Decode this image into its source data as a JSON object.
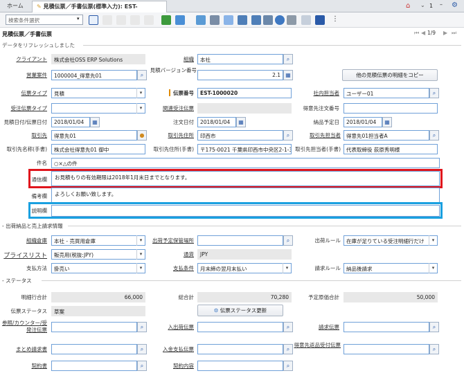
{
  "tabs": {
    "home": "ホーム",
    "active": "見積伝票／手書伝票(標準入力): EST-1000020"
  },
  "header": {
    "count": "1"
  },
  "search": {
    "placeholder": "検索条件選択"
  },
  "page": {
    "title": "見積伝票／手書伝票",
    "refresh_msg": "データをリフレッシュしました",
    "pager": "1/9"
  },
  "labels": {
    "client": "クライアント",
    "org": "組織",
    "deal": "営業案件",
    "quote_ver": "見積バージョン番号",
    "copy_btn": "他の見積伝票の明細をコピー",
    "doc_type": "伝票タイプ",
    "doc_no": "伝票番号",
    "sales_rep": "社内担当者",
    "order_type": "受注伝票タイプ",
    "rel_order": "関連受注伝票",
    "cust_order_no": "得意先注文番号",
    "date": "見積日付/伝票日付",
    "order_date": "注文日付",
    "delivery_date": "納品予定日",
    "partner": "取引先",
    "partner_addr": "取引先住所",
    "partner_contact": "取引先担当者",
    "partner_name_hand": "取引先名称(手書)",
    "partner_addr_hand": "取引先住所(手書)",
    "partner_contact_hand": "取引先担当者(手書)",
    "subject": "件名",
    "notice": "通信欄",
    "remarks": "備考欄",
    "description": "説明欄",
    "sec_ship": "- 出荷納品と売上請求情報",
    "warehouse": "組織倉庫",
    "ship_location": "出荷予定保管場所",
    "ship_rule": "出荷ルール",
    "pricelist": "プライスリスト",
    "currency": "通貨",
    "payment": "支払方法",
    "pay_term": "支払条件",
    "invoice_rule": "請求ルール",
    "sec_status": "- ステータス",
    "line_total": "明細行合計",
    "grand_total": "総合計",
    "budget_total": "予定原価合計",
    "status": "伝票ステータス",
    "status_btn": "伝票ステータス更新",
    "ref_counter": "参照/カウンター/受発注伝票",
    "inout": "入出荷伝票",
    "invoice": "請求伝票",
    "bundle": "まとめ請求書",
    "payment_doc": "入金支払伝票",
    "return_doc": "得意先返品受付伝票",
    "contract": "契約書",
    "contract_content": "契約内容"
  },
  "values": {
    "client": "株式会社OSS ERP Solutions",
    "org": "本社",
    "deal": "1000004_得意先01",
    "quote_ver": "2.1",
    "doc_type": "見積",
    "doc_no": "EST-1000020",
    "sales_rep": "ユーザー01",
    "date": "2018/01/04",
    "order_date": "2018/01/04",
    "delivery_date": "2018/01/04",
    "partner": "得意先01",
    "partner_addr": "印西市",
    "partner_contact": "得意先01担当者A",
    "partner_name_hand": "株式会社得意先01 御中",
    "partner_addr_hand": "〒175-0021 千葉県印西市中央区2-1-3",
    "partner_contact_hand": "代表取締役 荻原秀明様",
    "subject": "○×△の件",
    "notice": "お見積もりの有効期限は2018年1月末日までとなります。",
    "remarks": "よろしくお願い致します。",
    "warehouse": "本社 - 売買用倉庫",
    "ship_rule": "在庫が足りている受注明細行だけ",
    "pricelist": "販売用(税抜:JPY)",
    "currency": "JPY",
    "payment": "掛売い",
    "pay_term": "月末締の翌月末払い",
    "invoice_rule": "納品後請求",
    "line_total": "66,000",
    "grand_total": "70,280",
    "budget_total": "50,000",
    "status": "草案"
  }
}
